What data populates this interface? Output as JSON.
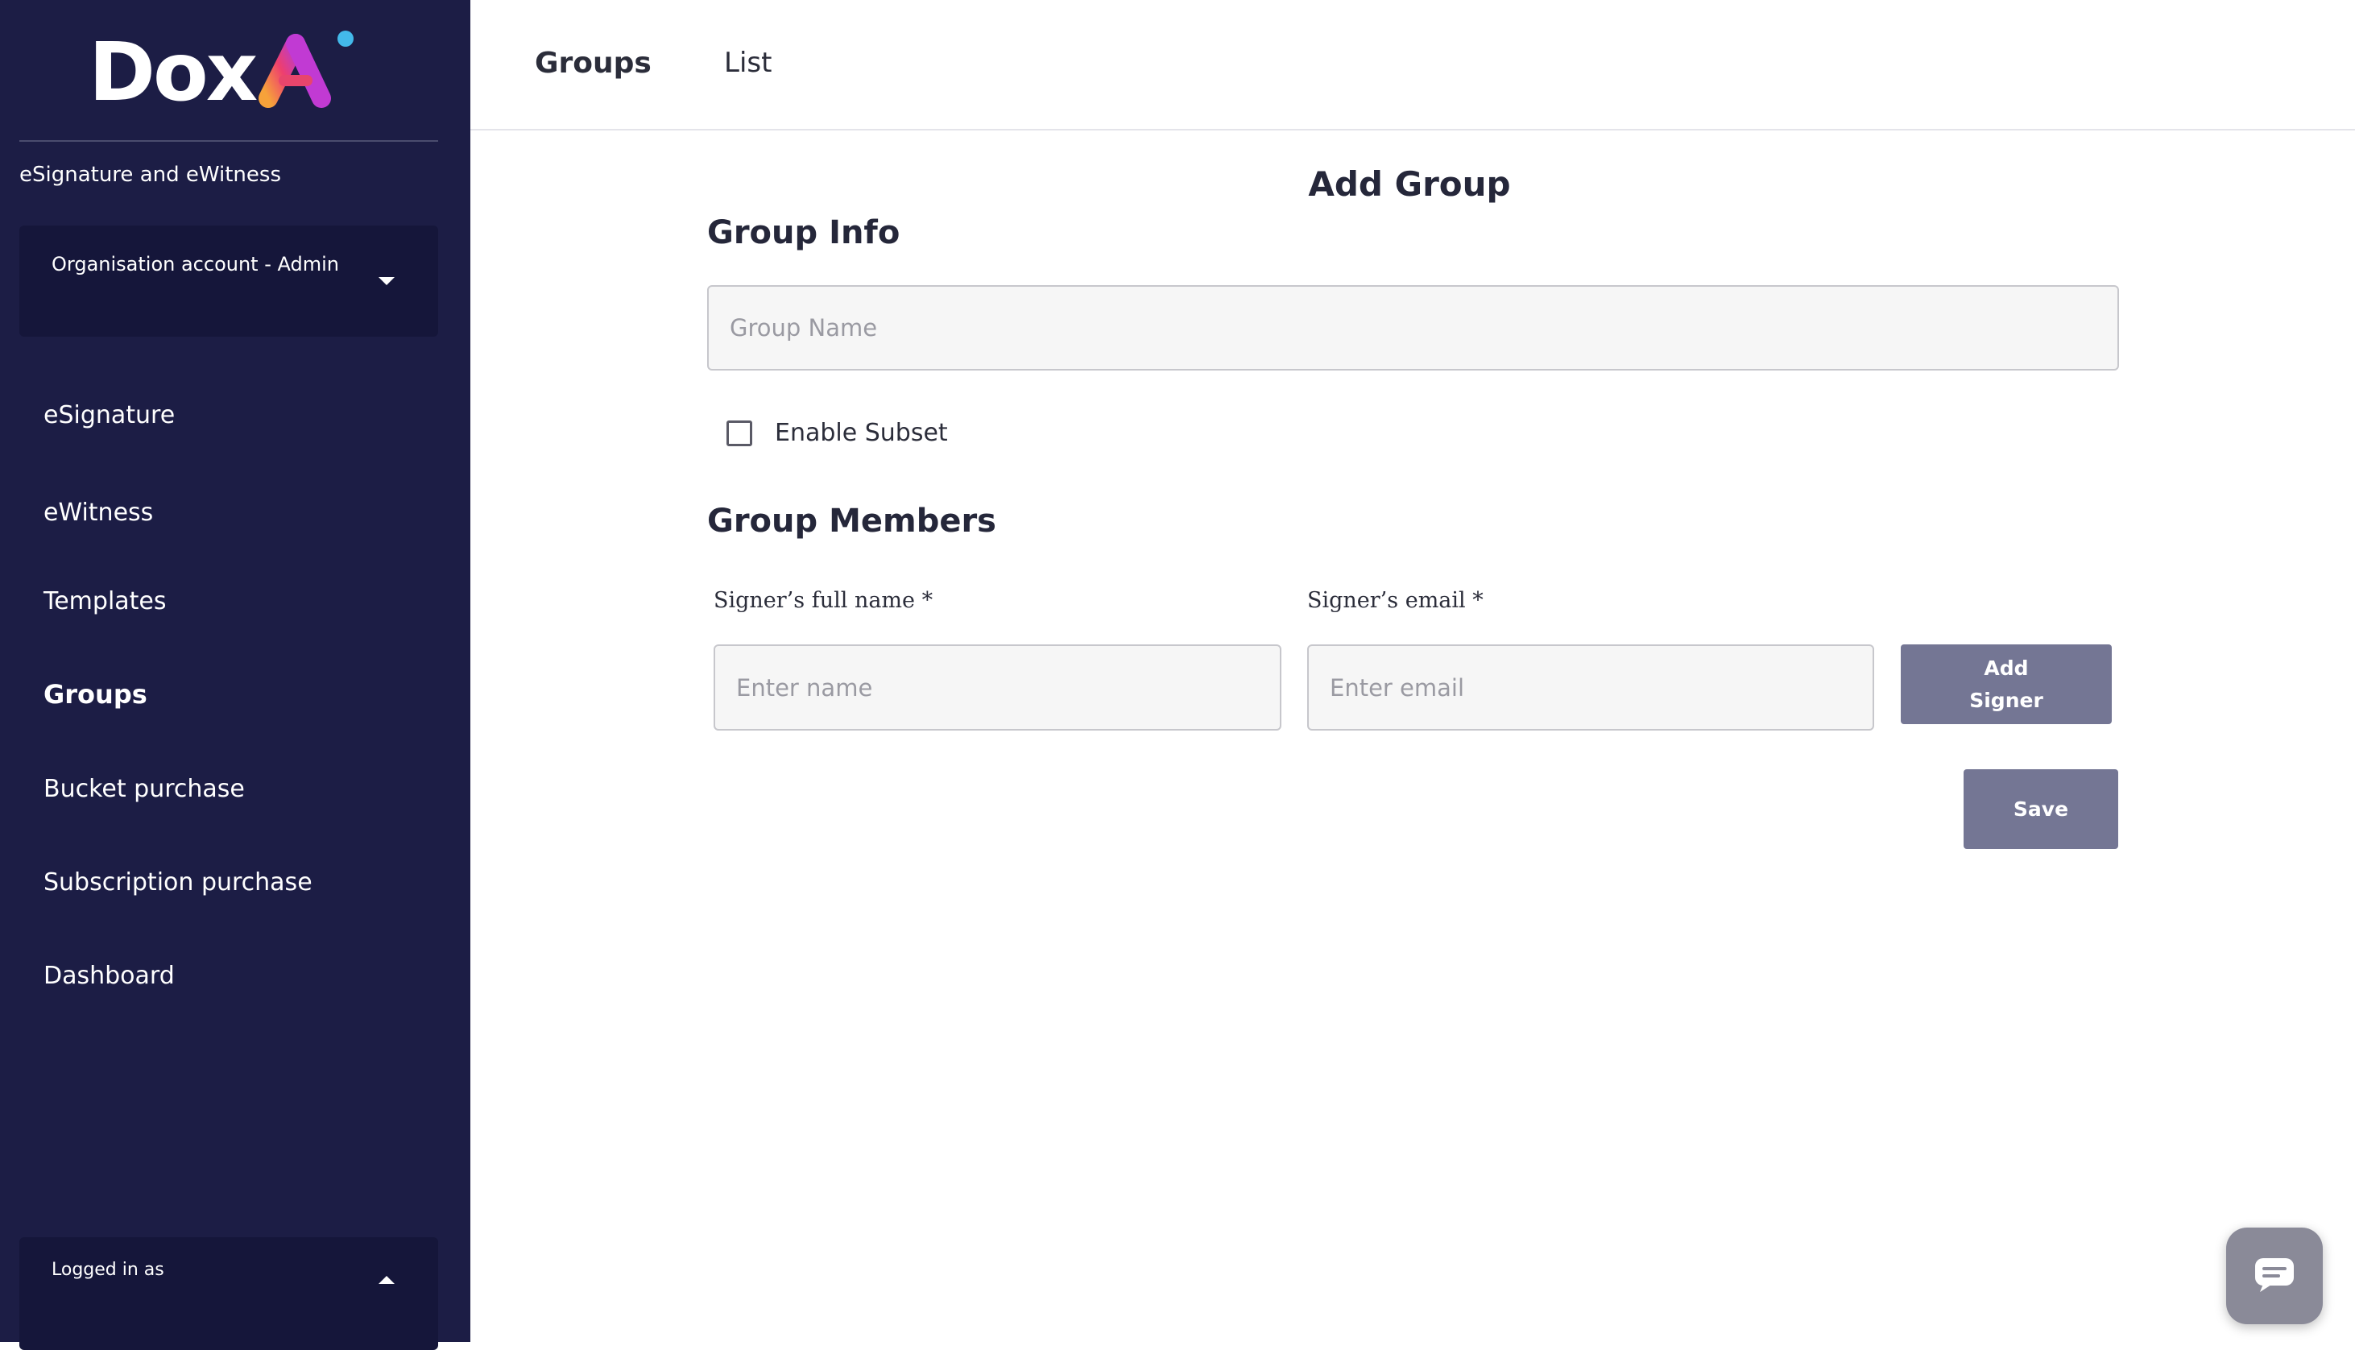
{
  "brand": {
    "logo_text": "Dox",
    "logo_mark_text": "AI",
    "tagline": "eSignature and eWitness"
  },
  "sidebar": {
    "account_selector": {
      "label": "Organisation account - Admin"
    },
    "items": [
      {
        "label": "eSignature"
      },
      {
        "label": "eWitness"
      },
      {
        "label": "Templates"
      },
      {
        "label": "Groups",
        "active": true
      },
      {
        "label": "Bucket purchase"
      },
      {
        "label": "Subscription purchase"
      },
      {
        "label": "Dashboard"
      }
    ],
    "logged_in": {
      "label": "Logged in as"
    }
  },
  "header": {
    "tabs": [
      {
        "label": "Groups",
        "active": true
      },
      {
        "label": "List"
      }
    ]
  },
  "main": {
    "title": "Add Group",
    "group_info": {
      "heading": "Group Info",
      "group_name_placeholder": "Group Name",
      "group_name_value": ""
    },
    "enable_subset": {
      "label": "Enable Subset",
      "checked": false
    },
    "group_members": {
      "heading": "Group Members",
      "name_label": "Signer’s full name *",
      "email_label": "Signer’s email *",
      "name_placeholder": "Enter name",
      "email_placeholder": "Enter email",
      "add_signer_line1": "Add",
      "add_signer_line2": "Signer"
    },
    "save_label": "Save"
  },
  "colors": {
    "sidebar_bg": "#1c1d45",
    "panel_bg": "#15163a",
    "button_bg": "#747694",
    "input_bg": "#f6f6f6",
    "chat_bg": "#8a8a98"
  },
  "icons": {
    "account_caret": "chevron-down-icon",
    "logged_caret": "chevron-up-icon",
    "chat": "chat-icon"
  }
}
